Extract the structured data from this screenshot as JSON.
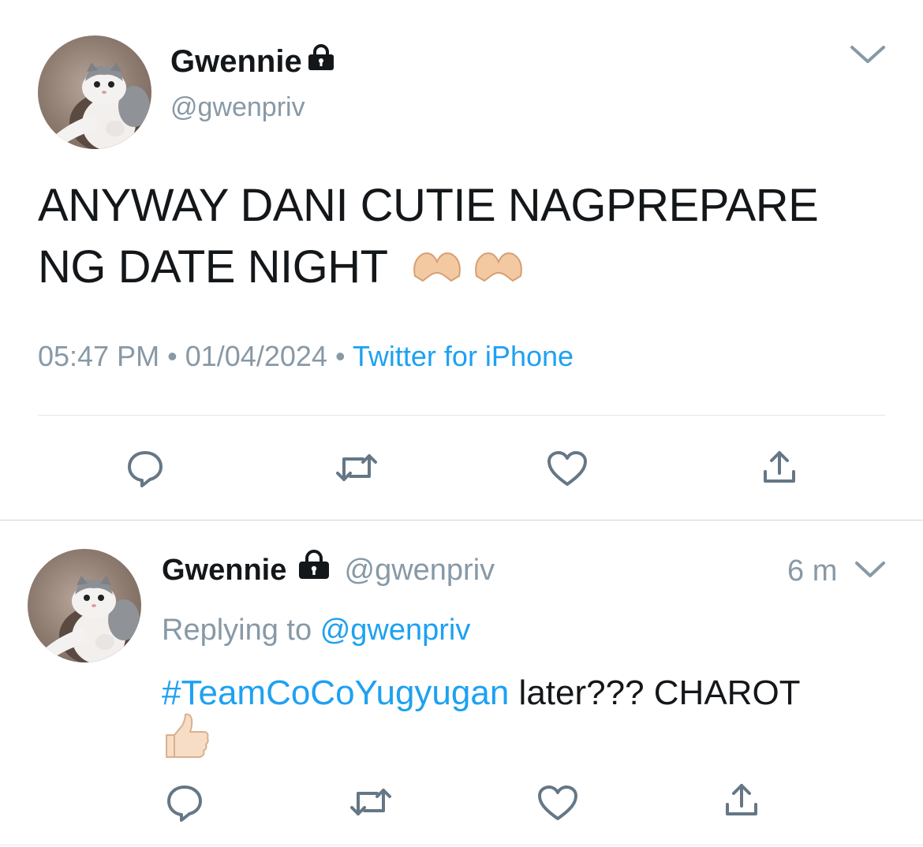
{
  "main_tweet": {
    "display_name": "Gwennie",
    "handle": "@gwenpriv",
    "text": "ANYWAY DANI CUTIE NAGPREPARE NG DATE NIGHT",
    "emoji": "heart-hands-emoji",
    "time": "05:47 PM",
    "separator": "•",
    "date": "01/04/2024",
    "source": "Twitter for iPhone"
  },
  "reply_tweet": {
    "display_name": "Gwennie",
    "handle": "@gwenpriv",
    "age": "6 m",
    "replying_prefix": "Replying to",
    "replying_handle": "@gwenpriv",
    "hashtag": "#TeamCoCoYugyugan",
    "text": "later??? CHAROT",
    "emoji": "thumbs-up-emoji"
  },
  "colors": {
    "accent": "#1da1f2",
    "secondary_text": "#8899a6",
    "icon": "#657786",
    "divider": "#e1e8ed"
  },
  "icons": [
    "lock-icon",
    "chevron-down-icon",
    "reply-icon",
    "retweet-icon",
    "like-icon",
    "share-icon"
  ]
}
